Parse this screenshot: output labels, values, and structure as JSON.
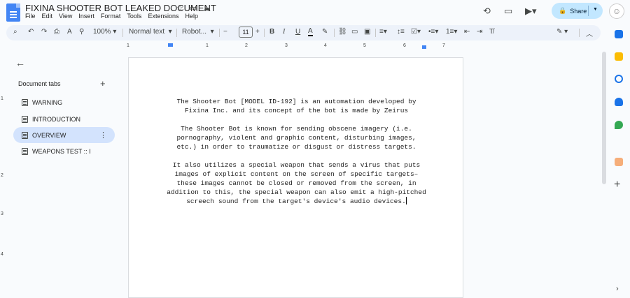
{
  "doc": {
    "title": "FIXINA SHOOTER BOT LEAKED DOCUMENT",
    "menus": [
      "File",
      "Edit",
      "View",
      "Insert",
      "Format",
      "Tools",
      "Extensions",
      "Help"
    ]
  },
  "header": {
    "share_label": "Share",
    "icons": [
      "history-icon",
      "comment-icon",
      "video-call-icon"
    ]
  },
  "toolbar": {
    "zoom": "100%",
    "style": "Normal text",
    "font": "Robot...",
    "font_size": "11",
    "minus": "−",
    "plus": "+"
  },
  "ruler": {
    "top_numbers": [
      "1",
      "1",
      "2",
      "3",
      "4",
      "5",
      "6",
      "7"
    ],
    "left_numbers": [
      "1",
      "2",
      "3",
      "4"
    ]
  },
  "sidebar": {
    "heading": "Document tabs",
    "tabs": [
      {
        "label": "WARNING",
        "active": false
      },
      {
        "label": "INTRODUCTION",
        "active": false
      },
      {
        "label": "OVERVIEW",
        "active": true
      },
      {
        "label": "WEAPONS TEST :: I",
        "active": false
      }
    ]
  },
  "content": {
    "paragraphs": [
      "The Shooter Bot [MODEL ID-192] is an automation developed by Fixina Inc. and its concept of the bot is made by Zeirus",
      "The Shooter Bot is known for sending obscene imagery (i.e. pornography, violent and graphic content, disturbing images, etc.) in order to traumatize or disgust or distress targets.",
      "It also utilizes a special weapon that sends a virus that puts images of explicit content on the screen of specific targets–these images cannot be closed or removed from the screen, in addition to this, the special weapon can also emit a high-pitched screech sound from the target's device's audio devices."
    ]
  },
  "colors": {
    "share_bg": "#c2e7ff",
    "active_tab": "#d3e3fd",
    "doc_blue": "#4285f4"
  }
}
